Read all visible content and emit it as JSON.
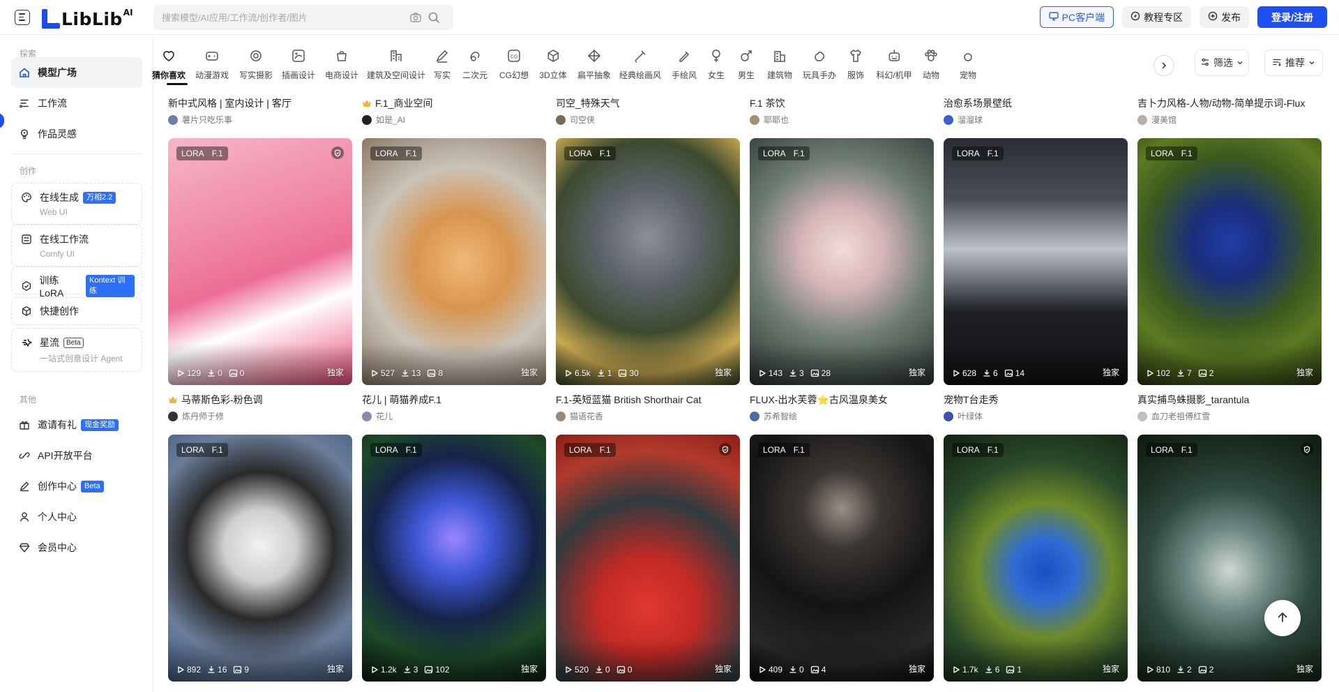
{
  "header": {
    "logo_text": "LibLib",
    "logo_sup": "AI",
    "search_placeholder": "搜索模型/AI应用/工作流/创作者/图片",
    "pc_client": "PC客户端",
    "tutorial": "教程专区",
    "publish": "发布",
    "login": "登录/注册"
  },
  "sidebar": {
    "section_explore": "探索",
    "explore": [
      {
        "label": "模型广场",
        "icon": "home-icon"
      },
      {
        "label": "工作流",
        "icon": "workflow-icon"
      },
      {
        "label": "作品灵感",
        "icon": "bulb-icon"
      }
    ],
    "section_create": "创作",
    "create": [
      {
        "label": "在线生成",
        "tag": "万相2.2",
        "sub": "Web UI",
        "icon": "palette-icon"
      },
      {
        "label": "在线工作流",
        "sub": "Comfy UI",
        "icon": "comfy-icon"
      },
      {
        "label": "训练LoRA",
        "tag": "Kontext 训练",
        "icon": "train-icon"
      },
      {
        "label": "快捷创作",
        "icon": "cube-icon"
      },
      {
        "label": "星流",
        "tag": "Beta",
        "sub": "一站式创意设计 Agent",
        "icon": "star-flow-icon"
      }
    ],
    "section_other": "其他",
    "other": [
      {
        "label": "邀请有礼",
        "tag": "现金奖励",
        "icon": "gift-icon"
      },
      {
        "label": "API开放平台",
        "icon": "link-icon"
      },
      {
        "label": "创作中心",
        "tag": "Beta",
        "icon": "pen-icon"
      },
      {
        "label": "个人中心",
        "icon": "user-icon"
      },
      {
        "label": "会员中心",
        "icon": "diamond-icon"
      }
    ]
  },
  "categories": [
    "猜你喜欢",
    "动漫游戏",
    "写实摄影",
    "插画设计",
    "电商设计",
    "建筑及空间设计",
    "写实",
    "二次元",
    "CG幻想",
    "3D立体",
    "扁平抽象",
    "经典绘画风",
    "手绘风",
    "女生",
    "男生",
    "建筑物",
    "玩具手办",
    "服饰",
    "科幻/机甲",
    "动物",
    "宠物"
  ],
  "filter_label": "筛选",
  "sort_label": "推荐",
  "top_row": [
    {
      "title": "新中式风格 | 室内设计 | 客厅",
      "author": "薯片只吃乐事",
      "av": "#6b7ea8"
    },
    {
      "title": "F.1_商业空间",
      "author": "如是_AI",
      "av": "#222222",
      "crown": true
    },
    {
      "title": "司空_特殊天气",
      "author": "司空侠",
      "av": "#7a6a5a"
    },
    {
      "title": "F.1 茶饮",
      "author": "耶耶也",
      "av": "#a09070"
    },
    {
      "title": "治愈系场景壁纸",
      "author": "溜溜球",
      "av": "#3f5fd0"
    },
    {
      "title": "吉卜力风格-人物/动物-简单提示词-Flux",
      "author": "漫美馆",
      "av": "#b8b0a8"
    }
  ],
  "row1": [
    {
      "badge1": "LORA",
      "badge2": "F.1",
      "shield": true,
      "runs": "129",
      "downloads": "0",
      "images": "0",
      "exclusive": "独家",
      "title": "马蒂斯色彩-粉色调",
      "author": "炼丹师于修",
      "crown": true,
      "av": "#333333",
      "bg": "linear-gradient(160deg,#f6b6c8 0%,#f08aa8 35%,#ec6d95 55%,#ffffff 70%,#e94f7a 100%)"
    },
    {
      "badge1": "LORA",
      "badge2": "F.1",
      "runs": "527",
      "downloads": "13",
      "images": "8",
      "exclusive": "独家",
      "title": "花儿 | 萌猫养成F.1",
      "author": "花儿",
      "av": "#8a8aaa",
      "bg": "radial-gradient(circle at 55% 50%,#f0b877 0%,#d99550 30%,#c9c2b8 60%,#8d7a65 100%)"
    },
    {
      "badge1": "LORA",
      "badge2": "F.1",
      "runs": "6.5k",
      "downloads": "1",
      "images": "30",
      "exclusive": "独家",
      "title": "F.1-英短蓝猫 British Shorthair Cat",
      "author": "猫语花香",
      "av": "#9b8a7a",
      "bg": "radial-gradient(circle at 50% 40%,#8a8f98 0%,#5d636c 28%,#3d4a2e 55%,#c9a850 78%,#314026 100%)"
    },
    {
      "badge1": "LORA",
      "badge2": "F.1",
      "runs": "143",
      "downloads": "3",
      "images": "28",
      "exclusive": "独家",
      "title": "FLUX-出水芙蓉⭐古风温泉美女",
      "author": "苏希智绘",
      "av": "#4a6aa8",
      "bg": "radial-gradient(circle at 50% 45%,#f2dcd6 0%,#d7b5b9 25%,#6e7d73 55%,#28322e 100%)"
    },
    {
      "badge1": "LORA",
      "badge2": "F.1",
      "runs": "628",
      "downloads": "6",
      "images": "14",
      "exclusive": "独家",
      "title": "宠物T台走秀",
      "author": "叶绿体",
      "av": "#3b52b0",
      "bg": "linear-gradient(180deg,#2a2d33 0%,#4a4e56 25%,#bcc2cc 45%,#1f2125 70%,#0f1012 100%)"
    },
    {
      "badge1": "LORA",
      "badge2": "F.1",
      "runs": "102",
      "downloads": "7",
      "images": "2",
      "exclusive": "独家",
      "title": "真实捕鸟蛛摄影_tarantula",
      "author": "血刀老祖傅红雪",
      "av": "#c0c0c0",
      "bg": "radial-gradient(circle at 50% 42%,#1f3da8 0%,#1a2e7a 22%,#3c5a1f 50%,#5c7a22 70%,#2a3612 100%)"
    }
  ],
  "row2": [
    {
      "badge1": "LORA",
      "badge2": "F.1",
      "runs": "892",
      "downloads": "16",
      "images": "9",
      "exclusive": "独家",
      "bg": "radial-gradient(circle at 50% 45%,#f2f2f2 0%,#cfcfcf 22%,#2a2a2a 45%,#6a7d9a 70%,#415a7e 100%)"
    },
    {
      "badge1": "LORA",
      "badge2": "F.1",
      "runs": "1.2k",
      "downloads": "3",
      "images": "102",
      "exclusive": "独家",
      "bg": "radial-gradient(circle at 50% 42%,#9a86ff 0%,#3e58d8 22%,#162348 48%,#1e4a2a 72%,#0c1a12 100%)"
    },
    {
      "badge1": "LORA",
      "badge2": "F.1",
      "shield": true,
      "runs": "520",
      "downloads": "0",
      "images": "0",
      "exclusive": "独家",
      "bg": "radial-gradient(circle at 50% 70%,#e0382f 0%,#c42a26 25%,#2f3a3e 55%,#b23a2c 80%,#8e1d18 100%)"
    },
    {
      "badge1": "LORA",
      "badge2": "F.1",
      "runs": "409",
      "downloads": "0",
      "images": "4",
      "exclusive": "独家",
      "bg": "radial-gradient(circle at 50% 30%,#9a8f86 0%,#3a3633 20%,#151414 50%,#2a2826 80%,#0a0a0a 100%)"
    },
    {
      "badge1": "LORA",
      "badge2": "F.1",
      "runs": "1.7k",
      "downloads": "6",
      "images": "1",
      "exclusive": "独家",
      "bg": "radial-gradient(circle at 55% 55%,#1a4fc0 0%,#2f6bd6 18%,#6e8a2a 40%,#2a4a2a 65%,#122012 100%)"
    },
    {
      "badge1": "LORA",
      "badge2": "F.1",
      "shield": true,
      "runs": "810",
      "downloads": "2",
      "images": "2",
      "exclusive": "独家",
      "bg": "radial-gradient(circle at 50% 55%,#cfd7d2 0%,#6f8a84 25%,#2f4a42 50%,#1d2e22 75%,#0d1a12 100%)"
    }
  ]
}
